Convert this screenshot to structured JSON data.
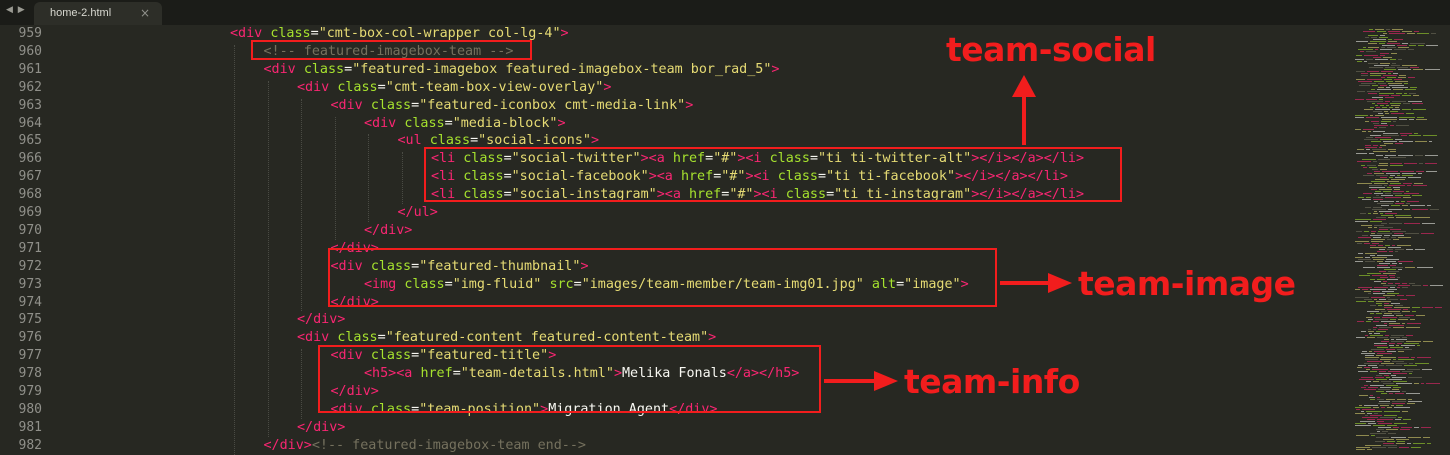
{
  "tab": {
    "nav_icon": "nav-arrows-icon",
    "nav_glyph": "◀ ▶",
    "label": "home-2.html",
    "close": "×"
  },
  "editor": {
    "lines": [
      {
        "n": "959",
        "indent": 0,
        "html": "<span class=\"tg\">&lt;div</span> <span class=\"at\">class</span>=<span class=\"st\">\"cmt-box-col-wrapper col-lg-4\"</span><span class=\"tg\">&gt;</span>"
      },
      {
        "n": "960",
        "indent": 1,
        "html": "<span class=\"cm\">&lt;!-- featured-imagebox-team --&gt;</span>"
      },
      {
        "n": "961",
        "indent": 1,
        "html": "<span class=\"tg\">&lt;div</span> <span class=\"at\">class</span>=<span class=\"st\">\"featured-imagebox featured-imagebox-team bor_rad_5\"</span><span class=\"tg\">&gt;</span>"
      },
      {
        "n": "962",
        "indent": 2,
        "html": "<span class=\"tg\">&lt;div</span> <span class=\"at\">class</span>=<span class=\"st\">\"cmt-team-box-view-overlay\"</span><span class=\"tg\">&gt;</span>"
      },
      {
        "n": "963",
        "indent": 3,
        "html": "<span class=\"tg\">&lt;div</span> <span class=\"at\">class</span>=<span class=\"st\">\"featured-iconbox cmt-media-link\"</span><span class=\"tg\">&gt;</span>"
      },
      {
        "n": "964",
        "indent": 4,
        "html": "<span class=\"tg\">&lt;div</span> <span class=\"at\">class</span>=<span class=\"st\">\"media-block\"</span><span class=\"tg\">&gt;</span>"
      },
      {
        "n": "965",
        "indent": 5,
        "html": "<span class=\"tg\">&lt;ul</span> <span class=\"at\">class</span>=<span class=\"st\">\"social-icons\"</span><span class=\"tg\">&gt;</span>"
      },
      {
        "n": "966",
        "indent": 6,
        "html": "<span class=\"tg\">&lt;li</span> <span class=\"at\">class</span>=<span class=\"st\">\"social-twitter\"</span><span class=\"tg\">&gt;&lt;a</span> <span class=\"at\">href</span>=<span class=\"st\">\"#\"</span><span class=\"tg\">&gt;&lt;i</span> <span class=\"at\">class</span>=<span class=\"st\">\"ti ti-twitter-alt\"</span><span class=\"tg\">&gt;&lt;/i&gt;&lt;/a&gt;&lt;/li&gt;</span>"
      },
      {
        "n": "967",
        "indent": 6,
        "html": "<span class=\"tg\">&lt;li</span> <span class=\"at\">class</span>=<span class=\"st\">\"social-facebook\"</span><span class=\"tg\">&gt;&lt;a</span> <span class=\"at\">href</span>=<span class=\"st\">\"#\"</span><span class=\"tg\">&gt;&lt;i</span> <span class=\"at\">class</span>=<span class=\"st\">\"ti ti-facebook\"</span><span class=\"tg\">&gt;&lt;/i&gt;&lt;/a&gt;&lt;/li&gt;</span>"
      },
      {
        "n": "968",
        "indent": 6,
        "html": "<span class=\"tg\">&lt;li</span> <span class=\"at\">class</span>=<span class=\"st\">\"social-instagram\"</span><span class=\"tg\">&gt;&lt;a</span> <span class=\"at\">href</span>=<span class=\"st\">\"#\"</span><span class=\"tg\">&gt;&lt;i</span> <span class=\"at\">class</span>=<span class=\"st\">\"ti ti-instagram\"</span><span class=\"tg\">&gt;&lt;/i&gt;&lt;/a&gt;&lt;/li&gt;</span>"
      },
      {
        "n": "969",
        "indent": 5,
        "html": "<span class=\"tg\">&lt;/ul&gt;</span>"
      },
      {
        "n": "970",
        "indent": 4,
        "html": "<span class=\"tg\">&lt;/div&gt;</span>"
      },
      {
        "n": "971",
        "indent": 3,
        "html": "<span class=\"tg\">&lt;/div&gt;</span>"
      },
      {
        "n": "972",
        "indent": 3,
        "html": "<span class=\"tg\">&lt;div</span> <span class=\"at\">class</span>=<span class=\"st\">\"featured-thumbnail\"</span><span class=\"tg\">&gt;</span>"
      },
      {
        "n": "973",
        "indent": 4,
        "html": "<span class=\"tg\">&lt;img</span> <span class=\"at\">class</span>=<span class=\"st\">\"img-fluid\"</span> <span class=\"at\">src</span>=<span class=\"st\">\"images/team-member/team-img01.jpg\"</span> <span class=\"at\">alt</span>=<span class=\"st\">\"image\"</span><span class=\"tg\">&gt;</span>"
      },
      {
        "n": "974",
        "indent": 3,
        "html": "<span class=\"tg\">&lt;/div&gt;</span>"
      },
      {
        "n": "975",
        "indent": 2,
        "html": "<span class=\"tg\">&lt;/div&gt;</span>"
      },
      {
        "n": "976",
        "indent": 2,
        "html": "<span class=\"tg\">&lt;div</span> <span class=\"at\">class</span>=<span class=\"st\">\"featured-content featured-content-team\"</span><span class=\"tg\">&gt;</span>"
      },
      {
        "n": "977",
        "indent": 3,
        "html": "<span class=\"tg\">&lt;div</span> <span class=\"at\">class</span>=<span class=\"st\">\"featured-title\"</span><span class=\"tg\">&gt;</span>"
      },
      {
        "n": "978",
        "indent": 4,
        "html": "<span class=\"tg\">&lt;h5&gt;&lt;a</span> <span class=\"at\">href</span>=<span class=\"st\">\"team-details.html\"</span><span class=\"tg\">&gt;</span>Melika Fonals<span class=\"tg\">&lt;/a&gt;&lt;/h5&gt;</span>"
      },
      {
        "n": "979",
        "indent": 3,
        "html": "<span class=\"tg\">&lt;/div&gt;</span>"
      },
      {
        "n": "980",
        "indent": 3,
        "html": "<span class=\"tg\">&lt;div</span> <span class=\"at\">class</span>=<span class=\"st\">\"team-position\"</span><span class=\"tg\">&gt;</span>Migration Agent<span class=\"tg\">&lt;/div&gt;</span>"
      },
      {
        "n": "981",
        "indent": 2,
        "html": "<span class=\"tg\">&lt;/div&gt;</span>"
      },
      {
        "n": "982",
        "indent": 1,
        "html": "<span class=\"tg\">&lt;/div&gt;</span><span class=\"cm\">&lt;!-- featured-imagebox-team end--&gt;</span>"
      }
    ]
  },
  "annotations": {
    "team_social": "team-social",
    "team_image": "team-image",
    "team_info": "team-info",
    "color": "#f21d1d"
  }
}
